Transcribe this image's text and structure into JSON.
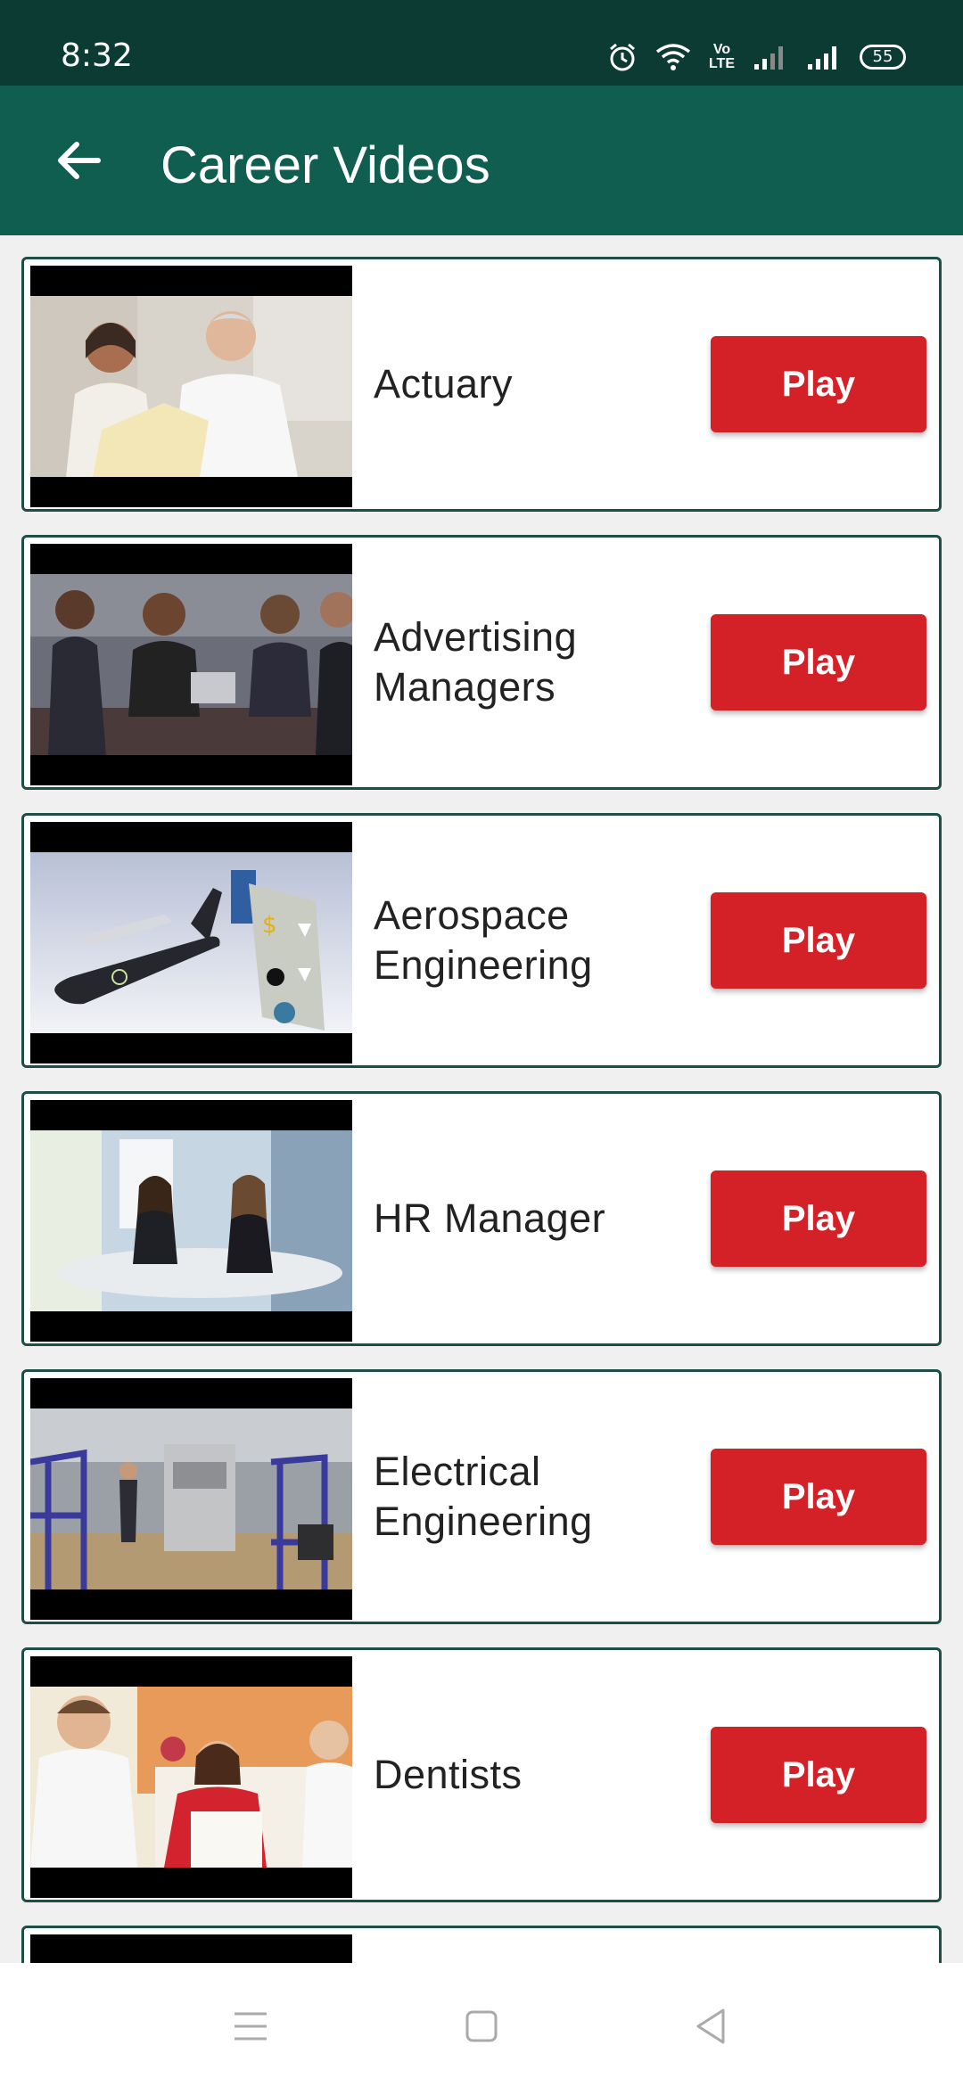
{
  "status_bar": {
    "time": "8:32",
    "volte_label": "Vo\nLTE",
    "battery": "55",
    "icons": [
      "alarm-icon",
      "wifi-icon",
      "volte-icon",
      "signal-weak-icon",
      "signal-strong-icon",
      "battery-icon"
    ]
  },
  "app_bar": {
    "title": "Career Videos",
    "back_icon": "arrow-left-icon"
  },
  "videos": [
    {
      "title": "Actuary",
      "play_label": "Play"
    },
    {
      "title": "Advertising Managers",
      "play_label": "Play"
    },
    {
      "title": "Aerospace Engineering",
      "play_label": "Play"
    },
    {
      "title": "HR Manager",
      "play_label": "Play"
    },
    {
      "title": "Electrical Engineering",
      "play_label": "Play"
    },
    {
      "title": "Dentists",
      "play_label": "Play"
    }
  ],
  "nav_bar": {
    "icons": [
      "menu-icon",
      "home-square-icon",
      "back-triangle-icon"
    ]
  },
  "colors": {
    "status_bar": "#0c3b33",
    "app_bar": "#0f5e50",
    "play_button": "#d42027",
    "card_border": "#1d4f47"
  }
}
